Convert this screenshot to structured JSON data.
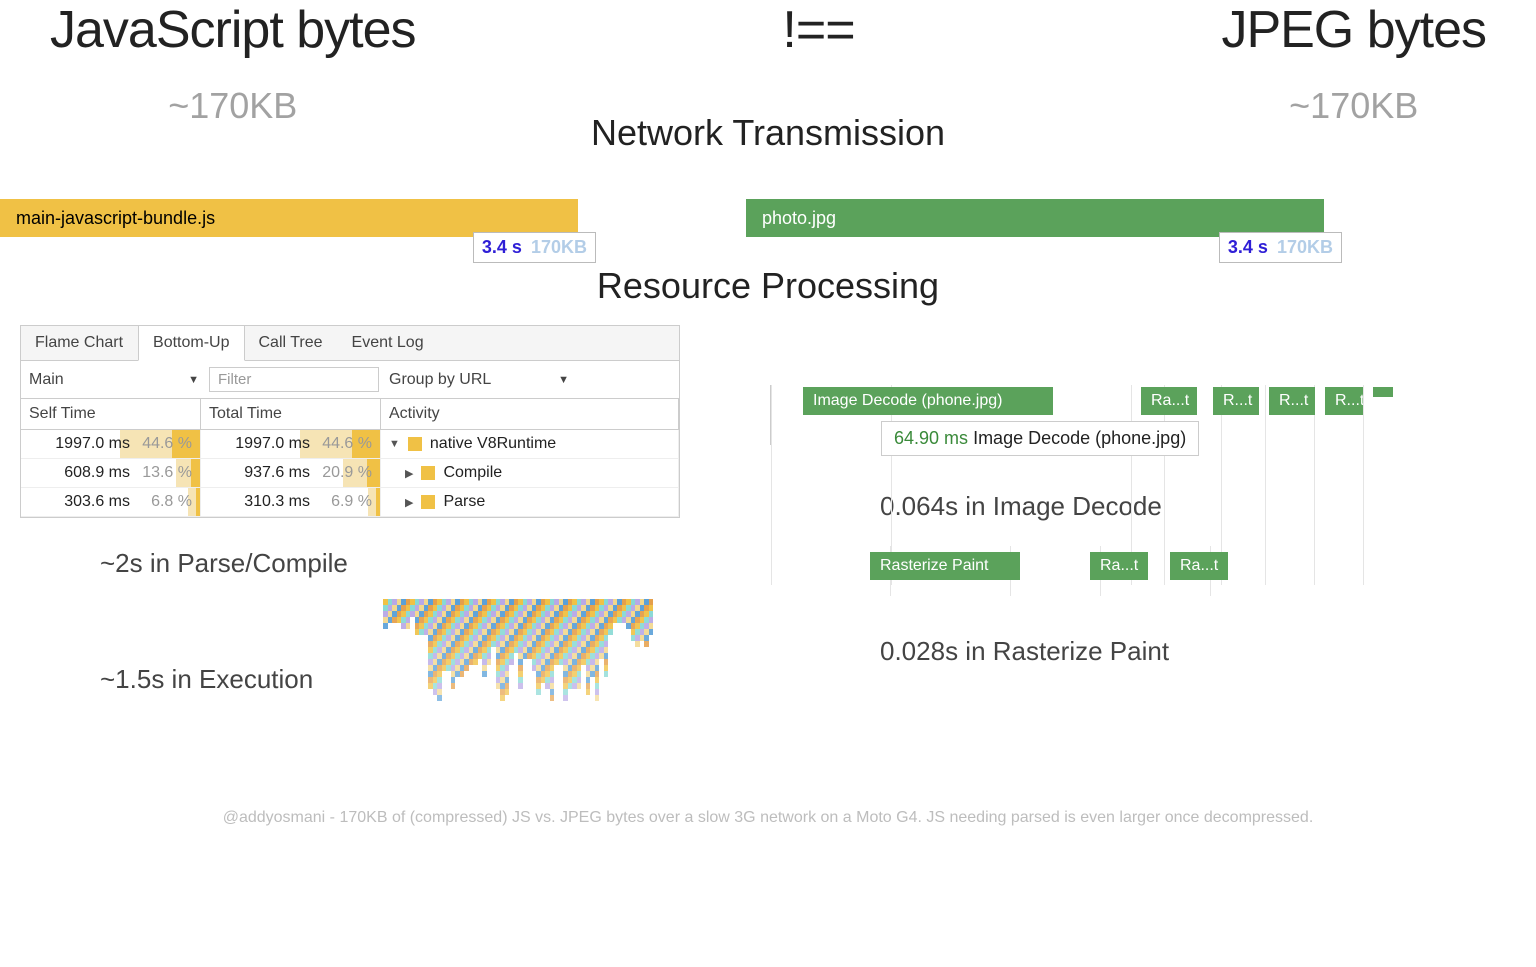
{
  "titles": {
    "left": "JavaScript bytes",
    "left_sub": "~170KB",
    "center": "!==",
    "right": "JPEG bytes",
    "right_sub": "~170KB"
  },
  "section_network": "Network Transmission",
  "section_processing": "Resource Processing",
  "bars": {
    "js": {
      "label": "main-javascript-bundle.js",
      "time": "3.4 s",
      "size": "170KB"
    },
    "jpeg": {
      "label": "photo.jpg",
      "time": "3.4 s",
      "size": "170KB"
    }
  },
  "devtools": {
    "tabs": [
      "Flame Chart",
      "Bottom-Up",
      "Call Tree",
      "Event Log"
    ],
    "active_tab_index": 1,
    "filter_track": "Main",
    "filter_placeholder": "Filter",
    "filter_group": "Group by URL",
    "cols": {
      "self": "Self Time",
      "total": "Total Time",
      "activity": "Activity"
    },
    "rows": [
      {
        "self_ms": "1997.0 ms",
        "self_pct": "44.6 %",
        "total_ms": "1997.0 ms",
        "total_pct": "44.6 %",
        "activity": "native V8Runtime",
        "expanded": true,
        "self_bar": 44.6,
        "total_bar": 44.6
      },
      {
        "self_ms": "608.9 ms",
        "self_pct": "13.6 %",
        "total_ms": "937.6 ms",
        "total_pct": "20.9 %",
        "activity": "Compile",
        "expanded": false,
        "self_bar": 13.6,
        "total_bar": 20.9
      },
      {
        "self_ms": "303.6 ms",
        "self_pct": "6.8 %",
        "total_ms": "310.3 ms",
        "total_pct": "6.9 %",
        "activity": "Parse",
        "expanded": false,
        "self_bar": 6.8,
        "total_bar": 6.9
      }
    ]
  },
  "summaries": {
    "parse_compile": "~2s in Parse/Compile",
    "execution": "~1.5s in Execution",
    "image_decode": "0.064s in Image Decode",
    "rasterize": "0.028s in Rasterize Paint"
  },
  "decode": {
    "main_label": "Image Decode (phone.jpg)",
    "short": "Ra...t",
    "short2": "R...t",
    "tooltip_ms": "64.90 ms",
    "tooltip_label": "Image Decode (phone.jpg)"
  },
  "raster": {
    "main_label": "Rasterize Paint",
    "short": "Ra...t"
  },
  "footnote": "@addyosmani - 170KB of (compressed) JS vs. JPEG bytes over a slow 3G network on a Moto G4. JS needing parsed is even larger once decompressed."
}
